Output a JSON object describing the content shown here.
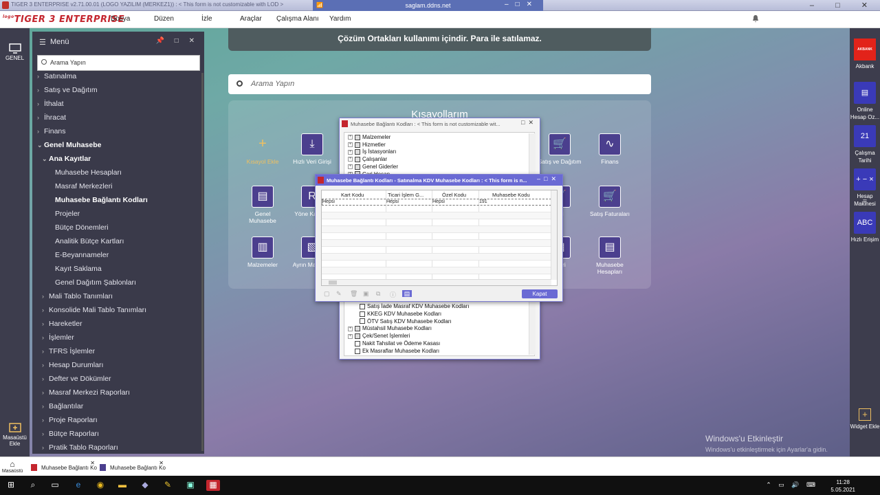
{
  "window": {
    "title": "TIGER 3 ENTERPRISE v2.71.00.01 (LOGO YAZILIM (MERKEZ1)) : < This form is not customizable with LOD >",
    "remote_host": "saglam.ddns.net"
  },
  "menubar": {
    "logo": "TIGER 3 ENTERPRISE",
    "logo_prefix": "logo",
    "items": [
      "Dosya",
      "Düzen",
      "İzle",
      "Araçlar",
      "Çalışma Alanı",
      "Yardım"
    ]
  },
  "left_strip": {
    "top_label": "GENEL",
    "bottom_label": "Masaüstü Ekle"
  },
  "menu": {
    "title": "Menü",
    "search_placeholder": "Arama Yapın",
    "items": [
      {
        "label": "Satınalma",
        "level": 0,
        "state": "collapsed"
      },
      {
        "label": "Satış ve Dağıtım",
        "level": 0,
        "state": "collapsed"
      },
      {
        "label": "İthalat",
        "level": 0,
        "state": "collapsed"
      },
      {
        "label": "İhracat",
        "level": 0,
        "state": "collapsed"
      },
      {
        "label": "Finans",
        "level": 0,
        "state": "collapsed"
      },
      {
        "label": "Genel Muhasebe",
        "level": 0,
        "state": "expanded"
      },
      {
        "label": "Ana Kayıtlar",
        "level": 1,
        "state": "expanded"
      },
      {
        "label": "Muhasebe Hesapları",
        "level": 2,
        "state": "leaf"
      },
      {
        "label": "Masraf Merkezleri",
        "level": 2,
        "state": "leaf"
      },
      {
        "label": "Muhasebe Bağlantı Kodları",
        "level": 2,
        "state": "selected"
      },
      {
        "label": "Projeler",
        "level": 2,
        "state": "leaf"
      },
      {
        "label": "Bütçe Dönemleri",
        "level": 2,
        "state": "leaf"
      },
      {
        "label": "Analitik Bütçe Kartları",
        "level": 2,
        "state": "leaf"
      },
      {
        "label": "E-Beyannameler",
        "level": 2,
        "state": "leaf"
      },
      {
        "label": "Kayıt Saklama",
        "level": 2,
        "state": "leaf"
      },
      {
        "label": "Genel Dağıtım Şablonları",
        "level": 2,
        "state": "leaf"
      },
      {
        "label": "Mali Tablo Tanımları",
        "level": 1,
        "state": "collapsed"
      },
      {
        "label": "Konsolide Mali Tablo Tanımları",
        "level": 1,
        "state": "collapsed"
      },
      {
        "label": "Hareketler",
        "level": 1,
        "state": "collapsed"
      },
      {
        "label": "İşlemler",
        "level": 1,
        "state": "collapsed"
      },
      {
        "label": "TFRS İşlemler",
        "level": 1,
        "state": "collapsed"
      },
      {
        "label": "Hesap Durumları",
        "level": 1,
        "state": "collapsed"
      },
      {
        "label": "Defter ve Dökümler",
        "level": 1,
        "state": "collapsed"
      },
      {
        "label": "Masraf Merkezi Raporları",
        "level": 1,
        "state": "collapsed"
      },
      {
        "label": "Bağlantılar",
        "level": 1,
        "state": "collapsed"
      },
      {
        "label": "Proje Raporları",
        "level": 1,
        "state": "collapsed"
      },
      {
        "label": "Bütçe Raporları",
        "level": 1,
        "state": "collapsed"
      },
      {
        "label": "Pratik Tablo Raporları",
        "level": 1,
        "state": "collapsed"
      }
    ]
  },
  "banner": "Çözüm Ortakları kullanımı içindir. Para ile satılamaz.",
  "search": {
    "placeholder": "Arama Yapın"
  },
  "shortcuts": {
    "title": "Kısayollarım",
    "items": [
      {
        "label": "Kısayol Ekle",
        "icon": "plus-icon"
      },
      {
        "label": "Hızlı Veri Girişi",
        "icon": "download-icon"
      },
      {
        "label": "Satış ve Dağıtım",
        "icon": "cart-icon"
      },
      {
        "label": "Finans",
        "icon": "trend-icon"
      },
      {
        "label": "Genel Muhasebe",
        "icon": "ledger-icon"
      },
      {
        "label": "Yöne Karar D",
        "icon": "report-icon"
      },
      {
        "label": "lari",
        "icon": "cart-icon"
      },
      {
        "label": "Satış Faturaları",
        "icon": "cart-icon"
      },
      {
        "label": "Malzemeler",
        "icon": "box-icon"
      },
      {
        "label": "Ayrın Mali Anal",
        "icon": "doc-icon"
      },
      {
        "label": "işleri",
        "icon": "doc-icon"
      },
      {
        "label": "Muhasebe Hesapları",
        "icon": "ledger-icon"
      }
    ]
  },
  "dialog_tree": {
    "title": "Muhasebe Bağlantı Kodları : < This form is not customizable wit...",
    "top_nodes": [
      "Malzemeler",
      "Hizmetler",
      "İş İstasyonları",
      "Çalışanlar",
      "Genel Giderler",
      "Cari Hesap"
    ],
    "bottom_nodes": [
      {
        "label": "Satış İade Masraf KDV Muhasebe Kodları",
        "indent": true,
        "expander": false
      },
      {
        "label": "KKEG KDV Muhasebe Kodları",
        "indent": true,
        "expander": false
      },
      {
        "label": "ÖTV Satış KDV Muhasebe Kodları",
        "indent": true,
        "expander": false
      },
      {
        "label": "Müstahsil Muhasebe Kodları",
        "indent": false,
        "expander": true
      },
      {
        "label": "Çek/Senet İşlemleri",
        "indent": false,
        "expander": true
      },
      {
        "label": "Nakit Tahsilat ve Ödeme Kasası",
        "indent": false,
        "expander": false
      },
      {
        "label": "Ek Masraflar Muhasebe Kodları",
        "indent": false,
        "expander": false
      }
    ]
  },
  "dialog_grid": {
    "title": "Muhasebe Bağlantı Kodları - Satınalma KDV Muhasebe Kodları : < This form is n...",
    "columns": [
      "Kart Kodu",
      "Ticari İşlem G...",
      "Özel Kodu",
      "Muhasebe Kodu"
    ],
    "rows": [
      [
        "Hepsi",
        "Hepsi",
        "Hepsi",
        "191"
      ]
    ],
    "close_label": "Kapat"
  },
  "right_strip": [
    {
      "label": "Akbank",
      "icon": "akbank-icon"
    },
    {
      "label": "Online Hesap Oz...",
      "icon": "invoice-icon"
    },
    {
      "label": "Çalışma Tarihi",
      "icon": "calendar-icon",
      "badge": "21"
    },
    {
      "label": "Hesap Makinesi",
      "icon": "calculator-icon"
    },
    {
      "label": "Hızlı Erişim",
      "icon": "abc-icon",
      "badge": "ABC"
    },
    {
      "label": "Widget Ekle",
      "icon": "plus-icon"
    }
  ],
  "watermark": {
    "title": "Windows'u Etkinleştir",
    "text": "Windows'u etkinleştirmek için Ayarlar'a gidin."
  },
  "bottom_tabs": {
    "home": "Masaüstü",
    "tabs": [
      "Muhasebe Bağlantı Ko",
      "Muhasebe Bağlantı Ko"
    ]
  },
  "taskbar": {
    "time": "11:28",
    "date": "5.05.2021"
  },
  "colors": {
    "accent": "#6a6ad4",
    "brand": "#c4262e",
    "panel": "#3a3a4a"
  }
}
